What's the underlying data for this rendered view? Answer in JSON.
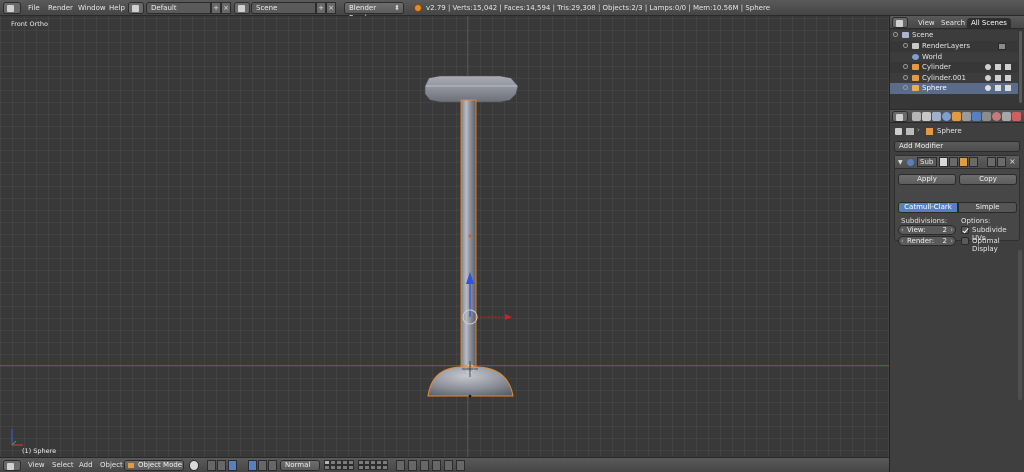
{
  "top_header": {
    "menus": [
      "File",
      "Render",
      "Window",
      "Help"
    ],
    "layout_name": "Default",
    "scene_name": "Scene",
    "render_engine": "Blender Render",
    "stats": "v2.79 | Verts:15,042 | Faces:14,594 | Tris:29,308 | Objects:2/3 | Lamps:0/0 | Mem:10.56M | Sphere",
    "close_glyph": "×",
    "plus_glyph": "+"
  },
  "viewport": {
    "view_label": "Front Ortho",
    "active_object_label": "(1) Sphere"
  },
  "view_header": {
    "menus": [
      "View",
      "Select",
      "Add",
      "Object"
    ],
    "mode": "Object Mode",
    "orientation": "Normal"
  },
  "outliner": {
    "tabs": [
      "View",
      "Search",
      "All Scenes"
    ],
    "rows": [
      "Scene",
      "RenderLayers",
      "World",
      "Cylinder",
      "Cylinder.001",
      "Sphere"
    ]
  },
  "properties": {
    "context_object": "Sphere",
    "add_modifier_label": "Add Modifier",
    "modifier_name": "Sub",
    "apply_label": "Apply",
    "copy_label": "Copy",
    "algorithm_options": [
      "Catmull-Clark",
      "Simple"
    ],
    "subdivisions_label": "Subdivisions:",
    "options_label": "Options:",
    "view_label": "View:",
    "view_value": "2",
    "render_label": "Render:",
    "render_value": "2",
    "subdivide_uvs_label": "Subdivide UVs",
    "optimal_display_label": "Optimal Display",
    "subdivide_uvs_checked": true,
    "optimal_display_checked": false
  },
  "colors": {
    "accent": "#5680c2",
    "selection_outline": "#e8892e",
    "axis_x": "#9a3d3d",
    "axis_z": "#3a47b8"
  }
}
